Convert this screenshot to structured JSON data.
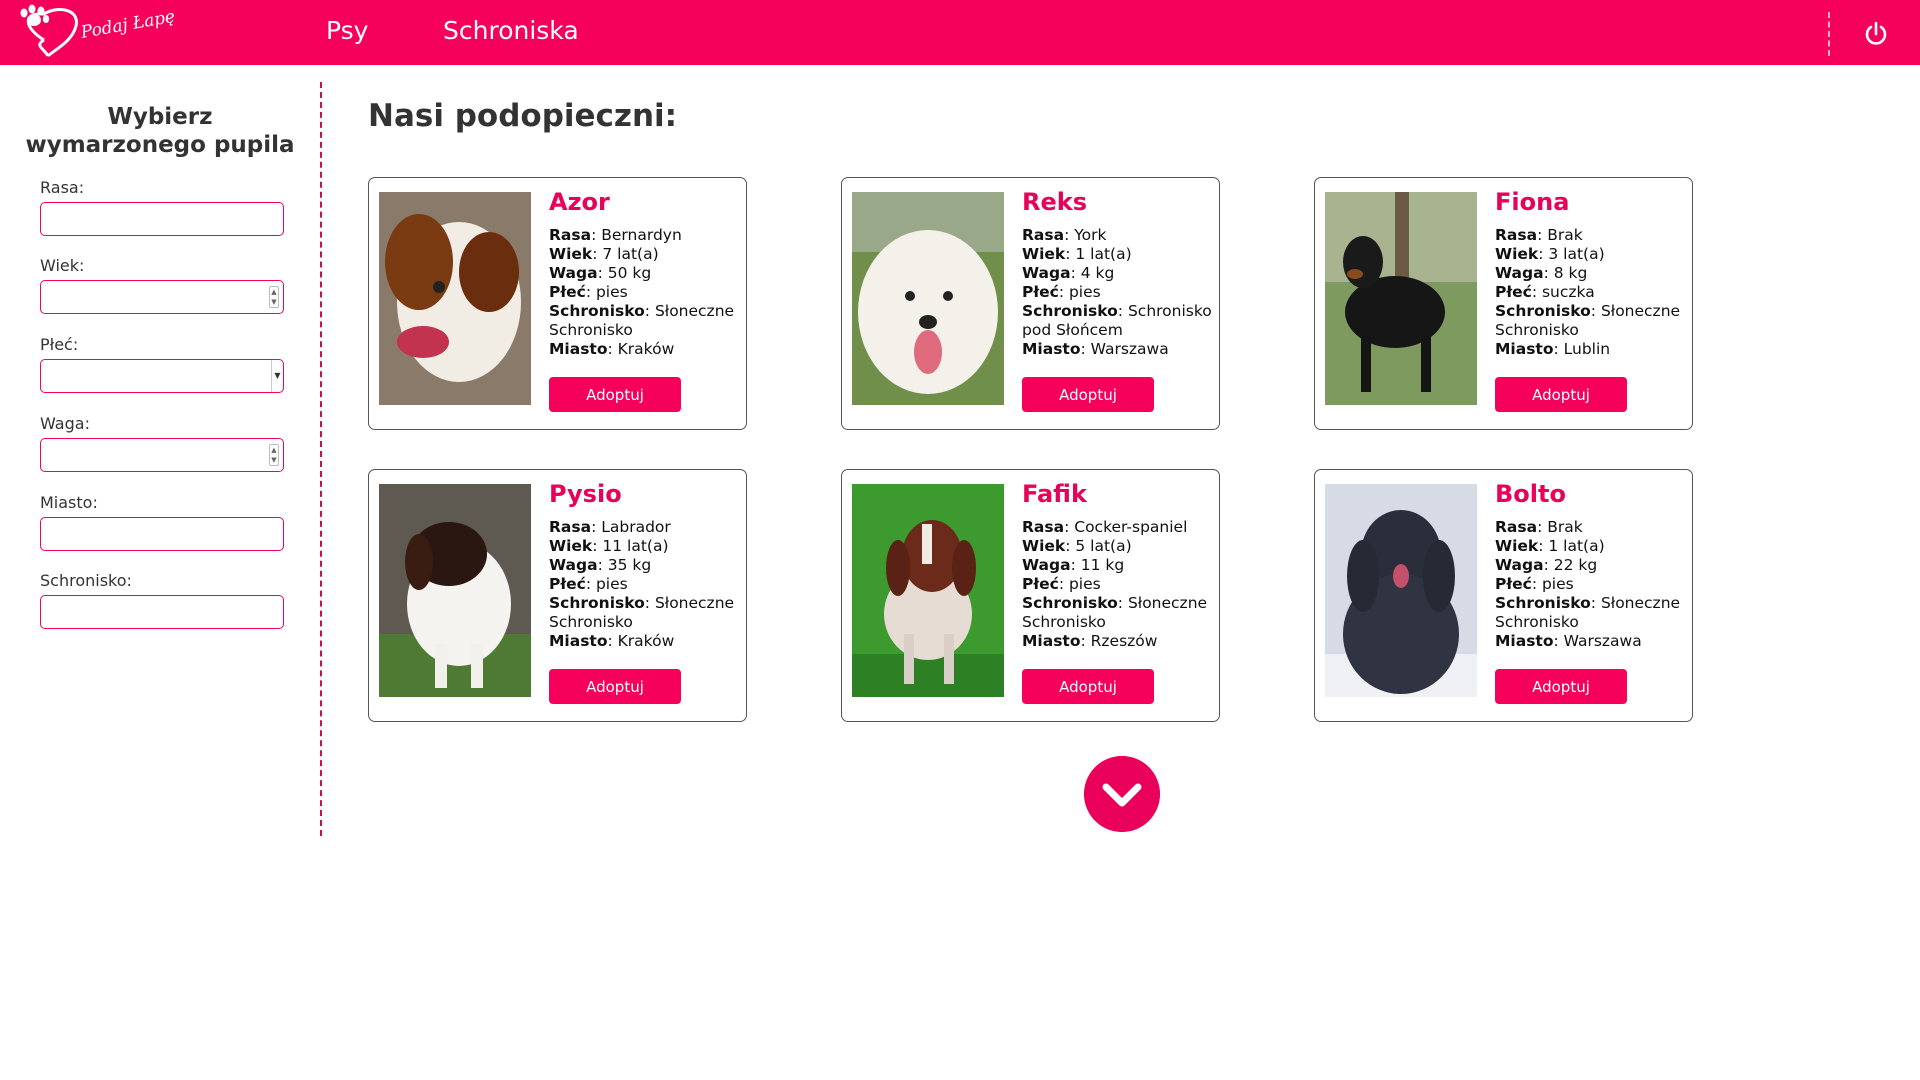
{
  "header": {
    "logo_text": "Podaj Łapę",
    "nav": [
      {
        "label": "Psy"
      },
      {
        "label": "Schroniska"
      }
    ],
    "power_icon": "power-icon"
  },
  "sidebar": {
    "title": "Wybierz wymarzonego pupila",
    "fields": {
      "rasa": {
        "label": "Rasa:",
        "value": ""
      },
      "wiek": {
        "label": "Wiek:",
        "value": ""
      },
      "plec": {
        "label": "Płeć:",
        "value": ""
      },
      "waga": {
        "label": "Waga:",
        "value": ""
      },
      "miasto": {
        "label": "Miasto:",
        "value": ""
      },
      "schronisko": {
        "label": "Schronisko:",
        "value": ""
      }
    }
  },
  "main": {
    "title": "Nasi podopieczni:",
    "labels": {
      "rasa": "Rasa",
      "wiek": "Wiek",
      "waga": "Waga",
      "plec": "Płeć",
      "schronisko": "Schronisko",
      "miasto": "Miasto"
    },
    "adopt_label": "Adoptuj",
    "dogs": [
      {
        "name": "Azor",
        "rasa": "Bernardyn",
        "wiek": "7 lat(a)",
        "waga": "50 kg",
        "plec": "pies",
        "schronisko": "Słoneczne Schronisko",
        "miasto": "Kraków"
      },
      {
        "name": "Reks",
        "rasa": "York",
        "wiek": "1 lat(a)",
        "waga": "4 kg",
        "plec": "pies",
        "schronisko": "Schronisko pod Słońcem",
        "miasto": "Warszawa"
      },
      {
        "name": "Fiona",
        "rasa": "Brak",
        "wiek": "3 lat(a)",
        "waga": "8 kg",
        "plec": "suczka",
        "schronisko": "Słoneczne Schronisko",
        "miasto": "Lublin"
      },
      {
        "name": "Pysio",
        "rasa": "Labrador",
        "wiek": "11 lat(a)",
        "waga": "35 kg",
        "plec": "pies",
        "schronisko": "Słoneczne Schronisko",
        "miasto": "Kraków"
      },
      {
        "name": "Fafik",
        "rasa": "Cocker-spaniel",
        "wiek": "5 lat(a)",
        "waga": "11 kg",
        "plec": "pies",
        "schronisko": "Słoneczne Schronisko",
        "miasto": "Rzeszów"
      },
      {
        "name": "Bolto",
        "rasa": "Brak",
        "wiek": "1 lat(a)",
        "waga": "22 kg",
        "plec": "pies",
        "schronisko": "Słoneczne Schronisko",
        "miasto": "Warszawa"
      }
    ],
    "more_icon": "chevron-down-icon"
  },
  "colors": {
    "brand": "#f5005a",
    "accent_text": "#e8005a",
    "divider": "#c8104c"
  }
}
